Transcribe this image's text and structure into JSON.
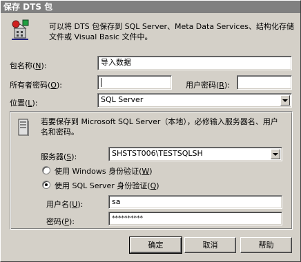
{
  "window": {
    "title": "保存 DTS 包"
  },
  "header": {
    "description_line1": "可以将 DTS 包保存到 SQL Server、Meta Data Services、结构化存储",
    "description_line2": "文件或 Visual Basic 文件中。"
  },
  "form": {
    "package_name": {
      "label": "包名称(N):",
      "value": "导入数据"
    },
    "owner_password": {
      "label": "所有者密码(O):",
      "value": ""
    },
    "user_password": {
      "label": "用户密码(R):",
      "value": ""
    },
    "location": {
      "label": "位置(L):",
      "value": "SQL Server"
    }
  },
  "server_group": {
    "info_line1": "若要保存到 Microsoft SQL Server（本地），必修输入服务器名、用户",
    "info_line2": "名和密码。",
    "server": {
      "label": "服务器(S):",
      "value": "SHSTST006\\TESTSQLSH"
    },
    "auth_windows": {
      "label": "使用 Windows 身份验证(W)",
      "checked": false
    },
    "auth_sql": {
      "label": "使用 SQL Server 身份验证(Q)",
      "checked": true
    },
    "username": {
      "label": "用户名(U):",
      "value": "sa"
    },
    "password": {
      "label": "密码(P):",
      "value": "**********"
    }
  },
  "buttons": {
    "ok": "确定",
    "cancel": "取消",
    "help": "帮助"
  },
  "icons": {
    "package_icon": "dts-package-icon",
    "server_icon": "server-icon"
  }
}
